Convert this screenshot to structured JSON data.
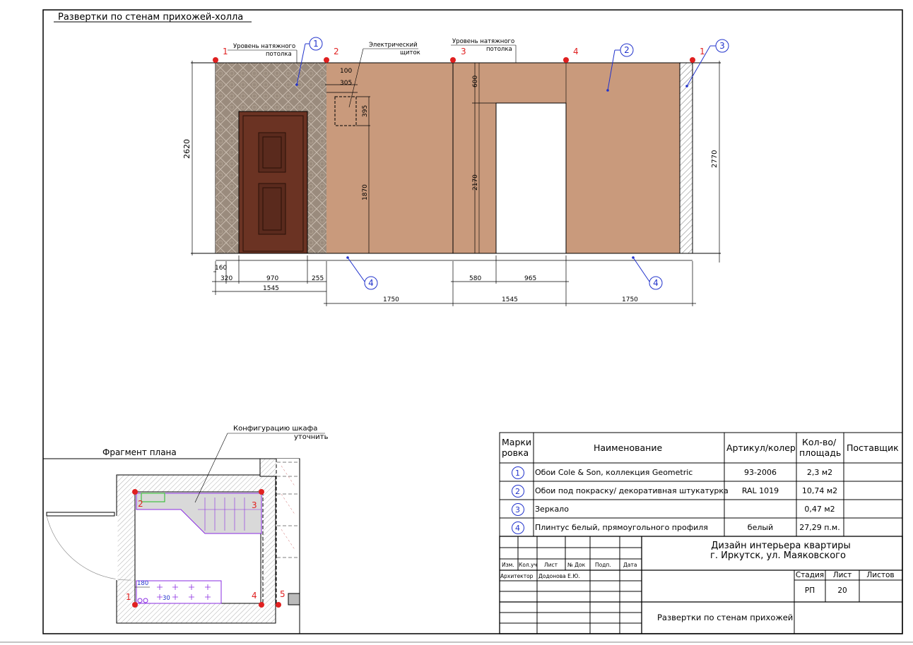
{
  "sheet_title": "Развертки по стенам прихожей-холла",
  "elevation": {
    "callout_ceiling_1": [
      "Уровень натяжного",
      "потолка"
    ],
    "callout_ceiling_2": [
      "Уровень натяжного",
      "потолка"
    ],
    "callout_panel": [
      "Электрический",
      "щиток"
    ],
    "corner_labels": [
      "1",
      "2",
      "3",
      "4",
      "1"
    ],
    "markers": [
      "1",
      "2",
      "3",
      "4",
      "4"
    ],
    "dims": {
      "height_left": "2620",
      "height_right": "2770",
      "panel_offset": "100",
      "panel_width": "305",
      "panel_height": "395",
      "panel_level": "1870",
      "above_opening": "600",
      "opening_height": "2170",
      "d160": "160",
      "d320": "320",
      "d970": "970",
      "d255": "255",
      "d1545a": "1545",
      "d580": "580",
      "d965": "965",
      "d1750a": "1750",
      "d1545b": "1545",
      "d1750b": "1750"
    }
  },
  "plan": {
    "title": "Фрагмент плана",
    "callout": [
      "Конфигурацию шкафа",
      "уточнить"
    ],
    "corner_labels": [
      "2",
      "3",
      "1",
      "4",
      "5"
    ],
    "dims": {
      "d180": "180",
      "d30": "30"
    }
  },
  "spec": {
    "headers": [
      "Марки ровка",
      "Наименование",
      "Артикул/колер",
      "Кол-во/ площадь",
      "Поставщик"
    ],
    "rows": [
      {
        "mark": "1",
        "name": "Обои Cole & Son, коллекция Geometric",
        "code": "93-2006",
        "qty": "2,3 м2",
        "supplier": ""
      },
      {
        "mark": "2",
        "name": "Обои под покраску/ декоративная штукатурка",
        "code": "RAL 1019",
        "qty": "10,74 м2",
        "supplier": ""
      },
      {
        "mark": "3",
        "name": "Зеркало",
        "code": "",
        "qty": "0,47 м2",
        "supplier": ""
      },
      {
        "mark": "4",
        "name": "Плинтус белый, прямоугольного профиля",
        "code": "белый",
        "qty": "27,29 п.м.",
        "supplier": ""
      }
    ]
  },
  "stamp": {
    "col_heads": [
      "Изм.",
      "Кол.уч",
      "Лист",
      "№ Док",
      "Подп.",
      "Дата"
    ],
    "role": "Архитектор",
    "person": "Додонова Е.Ю.",
    "project_line1": "Дизайн интерьера квартиры",
    "project_line2": "г. Иркутск, ул. Маяковского",
    "stage_label": "Стадия",
    "sheet_label": "Лист",
    "sheets_label": "Листов",
    "stage": "РП",
    "sheet": "20",
    "sheets": "",
    "drawing_name": "Развертки по стенам прихожей"
  },
  "colors": {
    "wall_paint": "#c99a7c",
    "wallpaper": "#9a8b7d",
    "door": "#6b3323",
    "marker_red": "#e02020",
    "callout_blue": "#2233cc",
    "cabinet": "#8a2be2"
  }
}
